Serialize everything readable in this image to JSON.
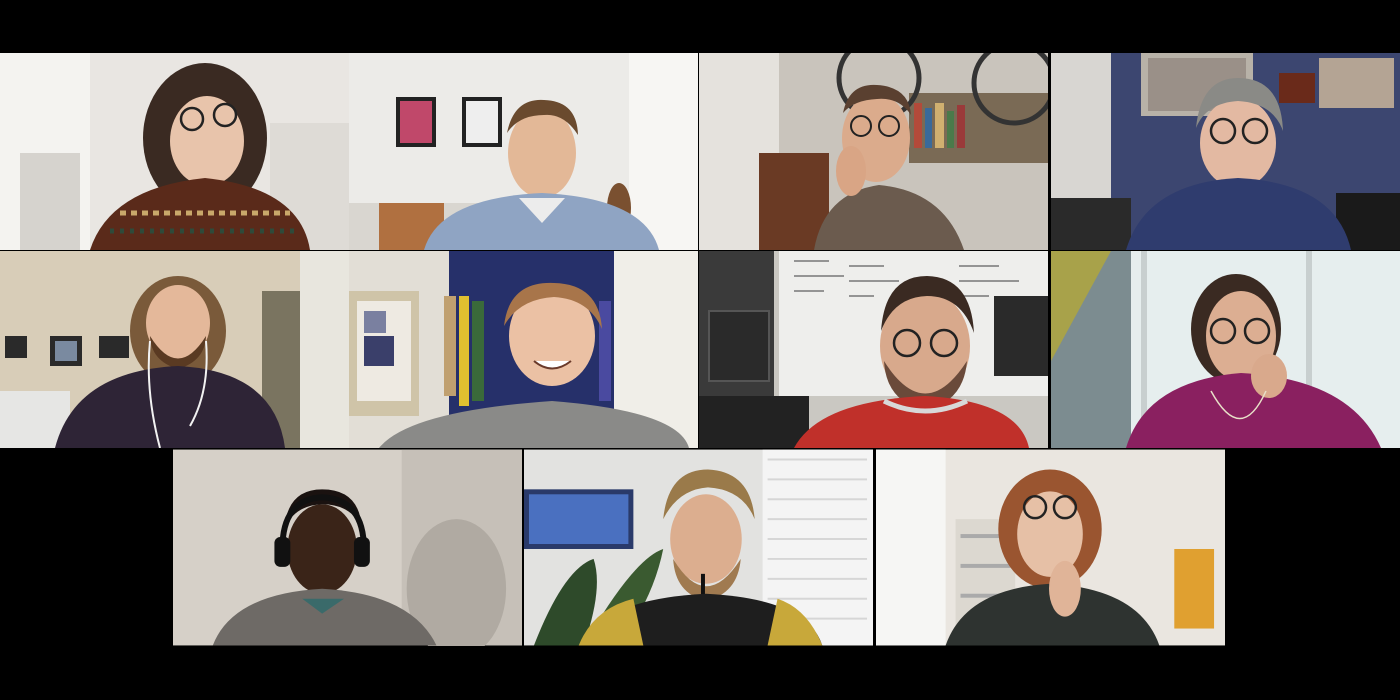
{
  "meeting": {
    "layout": "gallery",
    "participant_count": 11
  },
  "participants": [
    {
      "video": "participant-video"
    },
    {
      "video": "participant-video"
    },
    {
      "video": "participant-video"
    },
    {
      "video": "participant-video"
    },
    {
      "video": "participant-video"
    },
    {
      "video": "participant-video"
    },
    {
      "video": "participant-video"
    },
    {
      "video": "participant-video"
    },
    {
      "video": "participant-video"
    },
    {
      "video": "participant-video"
    },
    {
      "video": "participant-video"
    }
  ],
  "colors": {
    "background": "#000000"
  }
}
